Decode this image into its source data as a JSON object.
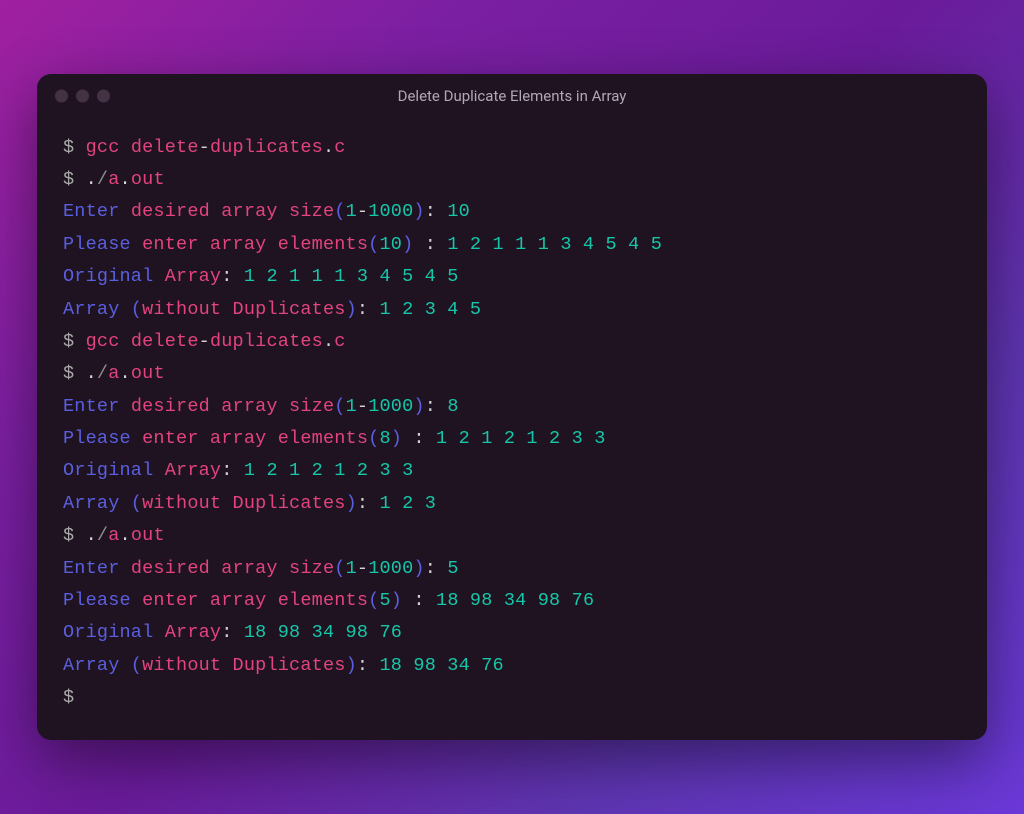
{
  "window": {
    "title": "Delete Duplicate Elements in Array"
  },
  "lines": [
    [
      {
        "cls": "t-prompt",
        "text": "$ "
      },
      {
        "cls": "t-magenta",
        "text": "gcc delete"
      },
      {
        "cls": "t-op",
        "text": "-"
      },
      {
        "cls": "t-magenta",
        "text": "duplicates"
      },
      {
        "cls": "t-op",
        "text": "."
      },
      {
        "cls": "t-magenta",
        "text": "c"
      }
    ],
    [
      {
        "cls": "t-prompt",
        "text": "$ "
      },
      {
        "cls": "t-op",
        "text": "."
      },
      {
        "cls": "t-dim",
        "text": "/"
      },
      {
        "cls": "t-magenta",
        "text": "a"
      },
      {
        "cls": "t-op",
        "text": "."
      },
      {
        "cls": "t-magenta",
        "text": "out"
      }
    ],
    [
      {
        "cls": "t-blue",
        "text": "Enter "
      },
      {
        "cls": "t-magenta",
        "text": "desired array size"
      },
      {
        "cls": "t-blue",
        "text": "("
      },
      {
        "cls": "t-teal",
        "text": "1"
      },
      {
        "cls": "t-op",
        "text": "-"
      },
      {
        "cls": "t-teal",
        "text": "1000"
      },
      {
        "cls": "t-blue",
        "text": ")"
      },
      {
        "cls": "t-op",
        "text": ": "
      },
      {
        "cls": "t-teal",
        "text": "10"
      }
    ],
    [
      {
        "cls": "t-blue",
        "text": "Please "
      },
      {
        "cls": "t-magenta",
        "text": "enter array elements"
      },
      {
        "cls": "t-blue",
        "text": "("
      },
      {
        "cls": "t-teal",
        "text": "10"
      },
      {
        "cls": "t-blue",
        "text": ") "
      },
      {
        "cls": "t-op",
        "text": ": "
      },
      {
        "cls": "t-teal",
        "text": "1 2 1 1 1 3 4 5 4 5"
      }
    ],
    [
      {
        "cls": "t-blue",
        "text": "Original "
      },
      {
        "cls": "t-magenta",
        "text": "Array"
      },
      {
        "cls": "t-op",
        "text": ": "
      },
      {
        "cls": "t-teal",
        "text": "1 2 1 1 1 3 4 5 4 5"
      }
    ],
    [
      {
        "cls": "t-blue",
        "text": "Array ("
      },
      {
        "cls": "t-magenta",
        "text": "without Duplicates"
      },
      {
        "cls": "t-blue",
        "text": ")"
      },
      {
        "cls": "t-op",
        "text": ": "
      },
      {
        "cls": "t-teal",
        "text": "1 2 3 4 5"
      }
    ],
    [
      {
        "cls": "t-prompt",
        "text": "$ "
      },
      {
        "cls": "t-magenta",
        "text": "gcc delete"
      },
      {
        "cls": "t-op",
        "text": "-"
      },
      {
        "cls": "t-magenta",
        "text": "duplicates"
      },
      {
        "cls": "t-op",
        "text": "."
      },
      {
        "cls": "t-magenta",
        "text": "c"
      }
    ],
    [
      {
        "cls": "t-prompt",
        "text": "$ "
      },
      {
        "cls": "t-op",
        "text": "."
      },
      {
        "cls": "t-dim",
        "text": "/"
      },
      {
        "cls": "t-magenta",
        "text": "a"
      },
      {
        "cls": "t-op",
        "text": "."
      },
      {
        "cls": "t-magenta",
        "text": "out"
      }
    ],
    [
      {
        "cls": "t-blue",
        "text": "Enter "
      },
      {
        "cls": "t-magenta",
        "text": "desired array size"
      },
      {
        "cls": "t-blue",
        "text": "("
      },
      {
        "cls": "t-teal",
        "text": "1"
      },
      {
        "cls": "t-op",
        "text": "-"
      },
      {
        "cls": "t-teal",
        "text": "1000"
      },
      {
        "cls": "t-blue",
        "text": ")"
      },
      {
        "cls": "t-op",
        "text": ": "
      },
      {
        "cls": "t-teal",
        "text": "8"
      }
    ],
    [
      {
        "cls": "t-blue",
        "text": "Please "
      },
      {
        "cls": "t-magenta",
        "text": "enter array elements"
      },
      {
        "cls": "t-blue",
        "text": "("
      },
      {
        "cls": "t-teal",
        "text": "8"
      },
      {
        "cls": "t-blue",
        "text": ") "
      },
      {
        "cls": "t-op",
        "text": ": "
      },
      {
        "cls": "t-teal",
        "text": "1 2 1 2 1 2 3 3"
      }
    ],
    [
      {
        "cls": "t-blue",
        "text": "Original "
      },
      {
        "cls": "t-magenta",
        "text": "Array"
      },
      {
        "cls": "t-op",
        "text": ": "
      },
      {
        "cls": "t-teal",
        "text": "1 2 1 2 1 2 3 3"
      }
    ],
    [
      {
        "cls": "t-blue",
        "text": "Array ("
      },
      {
        "cls": "t-magenta",
        "text": "without Duplicates"
      },
      {
        "cls": "t-blue",
        "text": ")"
      },
      {
        "cls": "t-op",
        "text": ": "
      },
      {
        "cls": "t-teal",
        "text": "1 2 3"
      }
    ],
    [
      {
        "cls": "t-prompt",
        "text": "$ "
      },
      {
        "cls": "t-op",
        "text": "."
      },
      {
        "cls": "t-dim",
        "text": "/"
      },
      {
        "cls": "t-magenta",
        "text": "a"
      },
      {
        "cls": "t-op",
        "text": "."
      },
      {
        "cls": "t-magenta",
        "text": "out"
      }
    ],
    [
      {
        "cls": "t-blue",
        "text": "Enter "
      },
      {
        "cls": "t-magenta",
        "text": "desired array size"
      },
      {
        "cls": "t-blue",
        "text": "("
      },
      {
        "cls": "t-teal",
        "text": "1"
      },
      {
        "cls": "t-op",
        "text": "-"
      },
      {
        "cls": "t-teal",
        "text": "1000"
      },
      {
        "cls": "t-blue",
        "text": ")"
      },
      {
        "cls": "t-op",
        "text": ": "
      },
      {
        "cls": "t-teal",
        "text": "5"
      }
    ],
    [
      {
        "cls": "t-blue",
        "text": "Please "
      },
      {
        "cls": "t-magenta",
        "text": "enter array elements"
      },
      {
        "cls": "t-blue",
        "text": "("
      },
      {
        "cls": "t-teal",
        "text": "5"
      },
      {
        "cls": "t-blue",
        "text": ") "
      },
      {
        "cls": "t-op",
        "text": ": "
      },
      {
        "cls": "t-teal",
        "text": "18 98 34 98 76"
      }
    ],
    [
      {
        "cls": "t-blue",
        "text": "Original "
      },
      {
        "cls": "t-magenta",
        "text": "Array"
      },
      {
        "cls": "t-op",
        "text": ": "
      },
      {
        "cls": "t-teal",
        "text": "18 98 34 98 76"
      }
    ],
    [
      {
        "cls": "t-blue",
        "text": "Array ("
      },
      {
        "cls": "t-magenta",
        "text": "without Duplicates"
      },
      {
        "cls": "t-blue",
        "text": ")"
      },
      {
        "cls": "t-op",
        "text": ": "
      },
      {
        "cls": "t-teal",
        "text": "18 98 34 76"
      }
    ],
    [
      {
        "cls": "t-prompt",
        "text": "$ "
      }
    ]
  ]
}
